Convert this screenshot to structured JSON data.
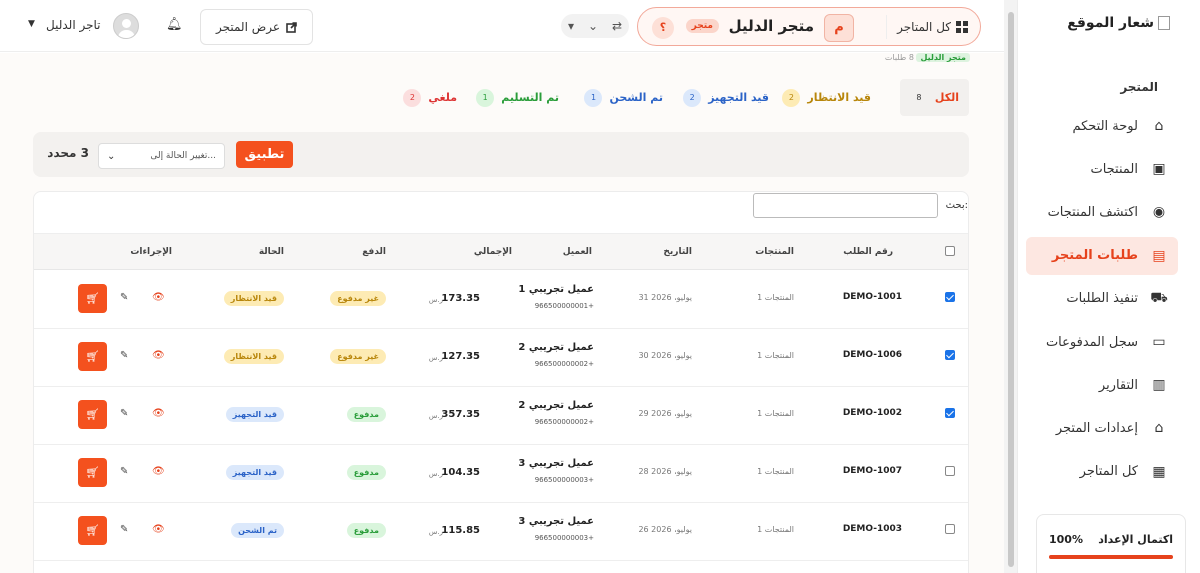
{
  "sidebar": {
    "logo_text": "شعار الموقع",
    "section_title": "المتجر",
    "items": [
      {
        "label": "لوحة التحكم",
        "icon": "home-icon"
      },
      {
        "label": "المنتجات",
        "icon": "box-icon"
      },
      {
        "label": "اكتشف المنتجات",
        "icon": "compass-icon"
      },
      {
        "label": "طلبات المتجر",
        "icon": "receipt-icon",
        "active": true
      },
      {
        "label": "تنفيذ الطلبات",
        "icon": "truck-icon"
      },
      {
        "label": "سجل المدفوعات",
        "icon": "money-icon"
      },
      {
        "label": "التقارير",
        "icon": "chart-icon"
      },
      {
        "label": "إعدادات المتجر",
        "icon": "store-icon"
      },
      {
        "label": "كل المتاجر",
        "icon": "grid-icon"
      }
    ],
    "setup": {
      "label": "اكتمال الإعداد",
      "percent": "100%",
      "progress": 1.0
    }
  },
  "header": {
    "all_stores": "كل المتاجر",
    "store_avatar": "م",
    "store_name": "متجر الدليل",
    "store_badge": "متجر",
    "help": "؟",
    "view_store": "عرض المتجر",
    "user_name": "تاجر الدليل"
  },
  "hidden_strip": {
    "badge": "متجر الدليل",
    "text": "8 طلبات"
  },
  "tabs": [
    {
      "label": "الكل",
      "count": "8",
      "color": "#e6421c",
      "badge_bg": "#f2f0ee"
    },
    {
      "label": "قيد الانتظار",
      "count": "2",
      "color": "#b8860b",
      "badge_bg": "#fdebb4"
    },
    {
      "label": "قيد التجهيز",
      "count": "2",
      "color": "#2b63c7",
      "badge_bg": "#dbe8fb"
    },
    {
      "label": "تم الشحن",
      "count": "1",
      "color": "#2b63c7",
      "badge_bg": "#dbe8fb"
    },
    {
      "label": "تم التسليم",
      "count": "1",
      "color": "#2a9d3a",
      "badge_bg": "#d9f5dc"
    },
    {
      "label": "ملغي",
      "count": "2",
      "color": "#d33",
      "badge_bg": "#fbdede"
    }
  ],
  "bulk": {
    "selected": "3 محدد",
    "select_placeholder": "تغيير الحالة إلى...",
    "apply": "تطبيق"
  },
  "table": {
    "search_label": "بحث:",
    "headers": [
      "رقم الطلب",
      "المنتجات",
      "التاريخ",
      "العميل",
      "الإجمالي",
      "الدفع",
      "الحالة",
      "الإجراءات"
    ],
    "rows": [
      {
        "checked": true,
        "order": "DEMO-1001",
        "products": "1 المنتجات",
        "date": "31 يوليو، 2026",
        "customer": "عميل تجريبي 1",
        "phone": "966500000001+",
        "total": "173.35",
        "currency": "ر.س",
        "payment": "غير مدفوع",
        "payment_kind": "unpaid",
        "status": "قيد الانتظار",
        "status_kind": "pending"
      },
      {
        "checked": true,
        "order": "DEMO-1006",
        "products": "1 المنتجات",
        "date": "30 يوليو، 2026",
        "customer": "عميل تجريبي 2",
        "phone": "966500000002+",
        "total": "127.35",
        "currency": "ر.س",
        "payment": "غير مدفوع",
        "payment_kind": "unpaid",
        "status": "قيد الانتظار",
        "status_kind": "pending"
      },
      {
        "checked": true,
        "order": "DEMO-1002",
        "products": "1 المنتجات",
        "date": "29 يوليو، 2026",
        "customer": "عميل تجريبي 2",
        "phone": "966500000002+",
        "total": "357.35",
        "currency": "ر.س",
        "payment": "مدفوع",
        "payment_kind": "paid",
        "status": "قيد التجهيز",
        "status_kind": "processing"
      },
      {
        "checked": false,
        "order": "DEMO-1007",
        "products": "1 المنتجات",
        "date": "28 يوليو، 2026",
        "customer": "عميل تجريبي 3",
        "phone": "966500000003+",
        "total": "104.35",
        "currency": "ر.س",
        "payment": "مدفوع",
        "payment_kind": "paid",
        "status": "قيد التجهيز",
        "status_kind": "processing"
      },
      {
        "checked": false,
        "order": "DEMO-1003",
        "products": "1 المنتجات",
        "date": "26 يوليو، 2026",
        "customer": "عميل تجريبي 3",
        "phone": "966500000003+",
        "total": "115.85",
        "currency": "ر.س",
        "payment": "مدفوع",
        "payment_kind": "paid",
        "status": "تم الشحن",
        "status_kind": "shipped"
      }
    ]
  }
}
